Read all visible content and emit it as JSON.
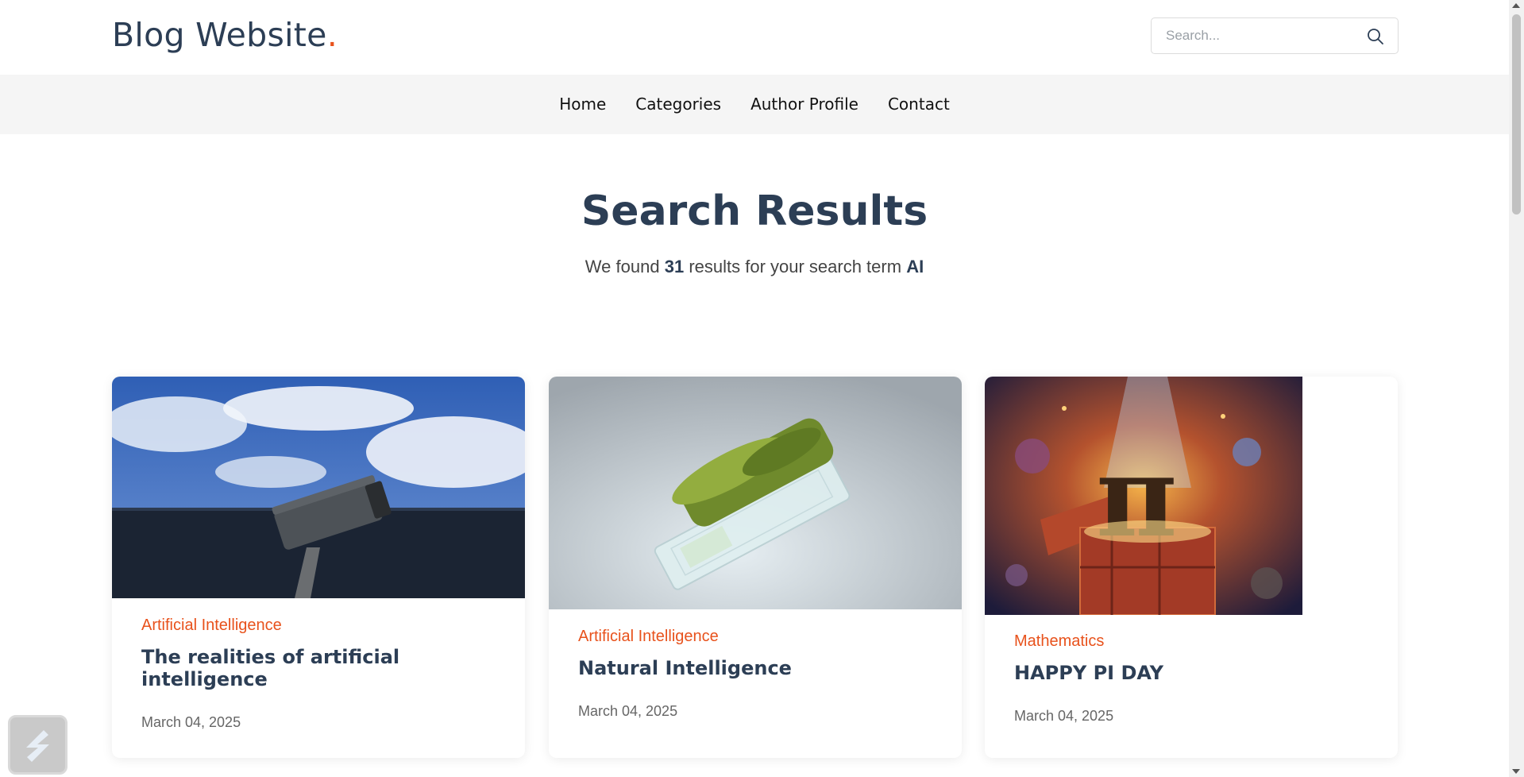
{
  "header": {
    "logo_text": "Blog Website",
    "logo_dot": ".",
    "search_placeholder": "Search..."
  },
  "nav": {
    "items": [
      {
        "label": "Home"
      },
      {
        "label": "Categories"
      },
      {
        "label": "Author Profile"
      },
      {
        "label": "Contact"
      }
    ]
  },
  "results": {
    "title": "Search Results",
    "prefix": "We found",
    "count": "31",
    "middle": "results for your search term",
    "term": "AI"
  },
  "cards": [
    {
      "category": "Artificial Intelligence",
      "title": "The realities of artificial intelligence",
      "date": "March 04, 2025",
      "image": "security-camera-sky"
    },
    {
      "category": "Artificial Intelligence",
      "title": "Natural Intelligence",
      "date": "March 04, 2025",
      "image": "moss-glass-chip"
    },
    {
      "category": "Mathematics",
      "title": "HAPPY PI DAY",
      "date": "March 04, 2025",
      "image": "pi-gift-box"
    }
  ],
  "colors": {
    "accent": "#e8521c",
    "heading": "#2c3e55",
    "nav_bg": "#f5f5f5"
  }
}
